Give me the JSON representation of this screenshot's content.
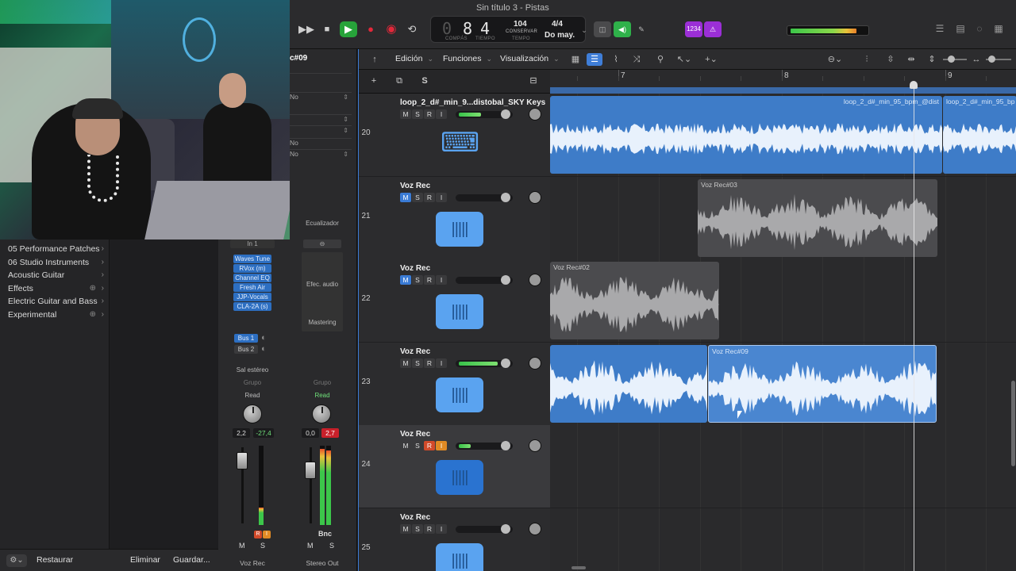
{
  "window_title": "Sin título 3 - Pistas",
  "transport": {
    "rewind": "◀◀",
    "forward": "▶▶",
    "stop": "■",
    "play": "▶",
    "record": "●",
    "cycle": "⟲",
    "bar": "8",
    "beat": "4",
    "bar_label": "COMPÁS",
    "beat_label": "TIEMPO",
    "tempo": "104",
    "tempo_mode": "CONSERVAR",
    "tempo_label": "TEMPO",
    "signature": "4/4",
    "key": "Do may."
  },
  "toolbar_badges": {
    "count_in": "1234",
    "metronome": "⚠"
  },
  "master_level": 0.88,
  "library": {
    "items": [
      {
        "label": "05 Performance Patches",
        "plus": false
      },
      {
        "label": "06 Studio Instruments",
        "plus": false
      },
      {
        "label": "Acoustic Guitar",
        "plus": false
      },
      {
        "label": "Effects",
        "plus": true
      },
      {
        "label": "Electric Guitar and Bass",
        "plus": false
      },
      {
        "label": "Experimental",
        "plus": true
      }
    ],
    "restore": "Restaurar",
    "delete": "Eliminar",
    "save": "Guardar..."
  },
  "inspector": {
    "region_name": "c#09",
    "no_1": "No",
    "no_2": "No",
    "no_3": "No",
    "strip1": {
      "input": "In 1",
      "plugins": [
        "Waves Tune",
        "RVox (m)",
        "Channel EQ",
        "Fresh Air",
        "JJP-Vocals",
        "CLA-2A (s)"
      ],
      "bus1": "Bus 1",
      "bus2": "Bus 2",
      "output": "Sal estéreo",
      "group": "Grupo",
      "automation": "Read",
      "vol": "2,2",
      "peak": "-27,4",
      "mute": "M",
      "solo": "S",
      "r": "R",
      "i": "I",
      "name": "Voz Rec"
    },
    "strip2": {
      "eq": "Ecualizador",
      "audio_fx": "Efec. audio",
      "mastering": "Mastering",
      "group": "Grupo",
      "automation": "Read",
      "vol": "0,0",
      "peak": "2,7",
      "bnc": "Bnc",
      "mute": "M",
      "solo": "S",
      "name": "Stereo Out"
    }
  },
  "edit_bar": {
    "edit": "Edición",
    "functions": "Funciones",
    "view": "Visualización"
  },
  "header_buttons": {
    "add": "+",
    "duplicate": "⧉",
    "solo": "S"
  },
  "ruler": {
    "bars": [
      "7",
      "8",
      "9"
    ]
  },
  "tracks": [
    {
      "num": "20",
      "name": "loop_2_d#_min_9...distobal_SKY Keys",
      "mute_on": false,
      "rec": false,
      "input": false,
      "vol_level": 0.48,
      "icon": "keyboard-icon",
      "regions": [
        {
          "title": "loop_2_d#_min_95_bpm_@dist",
          "style": "blue"
        },
        {
          "title": "loop_2_d#_min_95_bp",
          "style": "blue"
        }
      ]
    },
    {
      "num": "21",
      "name": "Voz Rec",
      "mute_on": true,
      "rec": false,
      "input": false,
      "vol_level": 0,
      "icon": "waveform-icon",
      "regions": [
        {
          "title": "Voz Rec#03",
          "style": "grey"
        }
      ]
    },
    {
      "num": "22",
      "name": "Voz Rec",
      "mute_on": true,
      "rec": false,
      "input": false,
      "vol_level": 0,
      "icon": "waveform-icon",
      "regions": [
        {
          "title": "Voz Rec#02",
          "style": "grey"
        }
      ]
    },
    {
      "num": "23",
      "name": "Voz Rec",
      "mute_on": false,
      "rec": false,
      "input": false,
      "vol_level": 0.85,
      "icon": "waveform-icon",
      "regions": [
        {
          "title": "",
          "style": "blue"
        },
        {
          "title": "Voz Rec#09",
          "style": "selected"
        }
      ]
    },
    {
      "num": "24",
      "name": "Voz Rec",
      "mute_on": false,
      "rec": true,
      "input": true,
      "vol_level": 0.25,
      "icon": "waveform-icon",
      "regions": []
    },
    {
      "num": "25",
      "name": "Voz Rec",
      "mute_on": false,
      "rec": false,
      "input": false,
      "vol_level": 0,
      "icon": "waveform-icon",
      "regions": []
    }
  ]
}
